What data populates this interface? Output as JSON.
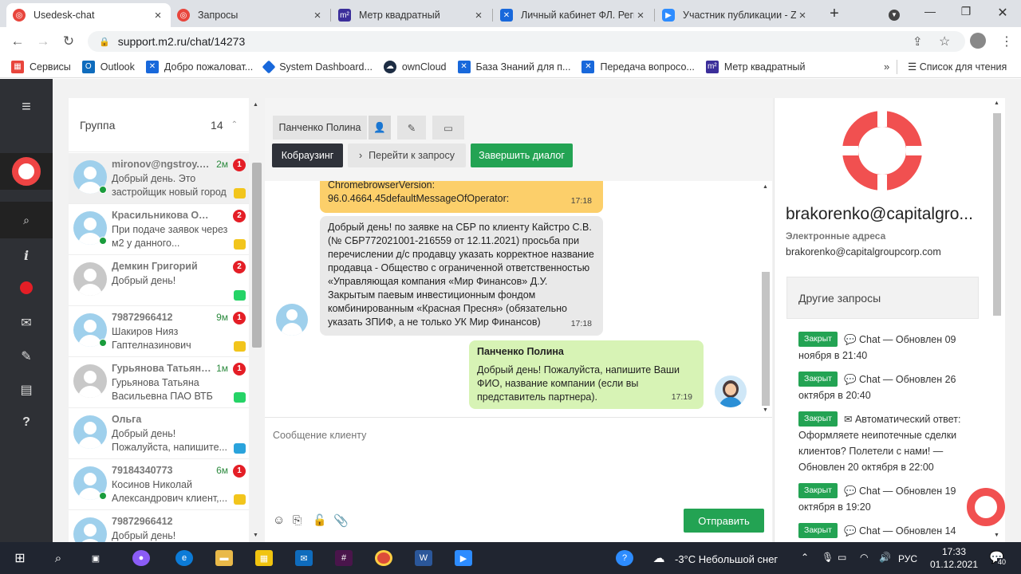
{
  "browser": {
    "tabs": [
      {
        "title": "Usedesk-chat",
        "active": true
      },
      {
        "title": "Запросы",
        "active": false
      },
      {
        "title": "Метр квадратный",
        "active": false
      },
      {
        "title": "Личный кабинет ФЛ. Регистрация",
        "active": false
      },
      {
        "title": "Участник публикации - Zoom",
        "active": false
      }
    ],
    "url": "support.m2.ru/chat/14273",
    "bookmarks": [
      {
        "label": "Сервисы",
        "icon": "apps-grid-icon",
        "color": "#e8453c"
      },
      {
        "label": "Outlook",
        "icon": "outlook-icon",
        "color": "#0f6cbd"
      },
      {
        "label": "Добро пожаловат...",
        "icon": "confluence-icon",
        "color": "#1868db"
      },
      {
        "label": "System Dashboard...",
        "icon": "jira-icon",
        "color": "#1868db"
      },
      {
        "label": "ownCloud",
        "icon": "owncloud-icon",
        "color": "#1d2d44"
      },
      {
        "label": "База Знаний для п...",
        "icon": "confluence-icon",
        "color": "#1868db"
      },
      {
        "label": "Передача вопросо...",
        "icon": "confluence-icon",
        "color": "#1868db"
      },
      {
        "label": "Метр квадратный",
        "icon": "m2-icon",
        "color": "#3b2e9a"
      }
    ],
    "more_bookmarks": "»",
    "reading_list": "Список для чтения"
  },
  "list": {
    "group_label": "Группа",
    "group_count": "14",
    "chats": [
      {
        "name": "mironov@ngstroy.com",
        "text": "Добрый день. Это застройщик новый город",
        "time": "2м",
        "badge": "1",
        "channel": "chat",
        "status": "#1a9c3c",
        "grey": false
      },
      {
        "name": "Красильникова Ольга",
        "text": "При подаче заявок через м2 у данного...",
        "time": "",
        "badge": "2",
        "channel": "chat",
        "status": "#1a9c3c",
        "grey": false
      },
      {
        "name": "Демкин Григорий",
        "text": "Добрый день!",
        "time": "",
        "badge": "2",
        "channel": "whatsapp",
        "status": "",
        "grey": true
      },
      {
        "name": "79872966412",
        "text": "Шакиров Нияз Гаптелназинович",
        "time": "9м",
        "badge": "1",
        "channel": "chat",
        "status": "#1a9c3c",
        "grey": false
      },
      {
        "name": "Гурьянова Татьяна Васильевна",
        "text": "Гурьянова Татьяна Васильевна ПАО ВТБ",
        "time": "1м",
        "badge": "1",
        "channel": "whatsapp",
        "status": "",
        "grey": true
      },
      {
        "name": "Ольга",
        "text": "Добрый день! Пожалуйста, напишите...",
        "time": "",
        "badge": "",
        "channel": "telegram",
        "status": "",
        "grey": false
      },
      {
        "name": "79184340773",
        "text": "Косинов Николай Александрович клиент,...",
        "time": "6м",
        "badge": "1",
        "channel": "chat",
        "status": "#1a9c3c",
        "grey": false
      },
      {
        "name": "79872966412",
        "text": "Добрый день! Пожалуйста, напишите...",
        "time": "",
        "badge": "",
        "channel": "chat",
        "status": "#e41e26",
        "grey": false
      }
    ]
  },
  "chat": {
    "assignee": "Панченко Полина",
    "cobrowsing_label": "Кобраузинг",
    "goto_request_label": "Перейти к запросу",
    "finish_label": "Завершить диалог",
    "messages": [
      {
        "text": "ChromebrowserVersion: 96.0.4664.45defaultMessageOfOperator:",
        "time": "17:18"
      },
      {
        "text": "Добрый день! по заявке на СБР по клиенту Кайстро С.В. (№ СБР772021001-216559 от 12.11.2021) просьба при перечислении д/с продавцу указать корректное название продавца - Общество с ограниченной ответственностью «Управляющая компания «Мир Финансов» Д.У. Закрытым паевым инвестиционным фондом комбинированным «Красная Пресня» (обязательно указать ЗПИФ, а не только УК Мир Финансов)",
        "time": "17:18"
      },
      {
        "author": "Панченко Полина",
        "text": "Добрый день! Пожалуйста, напишите Ваши ФИО, название компании (если вы представитель партнера).",
        "time": "17:19"
      }
    ],
    "input_placeholder": "Сообщение клиенту",
    "send_label": "Отправить"
  },
  "client": {
    "name": "brakorenko@capitalgro...",
    "emails_label": "Электронные адреса",
    "email": "brakorenko@capitalgroupcorp.com",
    "other_requests_label": "Другие запросы",
    "requests": [
      {
        "status": "Закрыт",
        "text": "Chat — Обновлен 09 ноября в 21:40"
      },
      {
        "status": "Закрыт",
        "text": "Chat — Обновлен 26 октября в 20:40"
      },
      {
        "status": "Закрыт",
        "text": "Автоматический ответ: Оформляете неипотечные сделки клиентов? Полетели с нами! — Обновлен 20 октября в 22:00"
      },
      {
        "status": "Закрыт",
        "text": "Chat — Обновлен 19 октября в 19:20"
      },
      {
        "status": "Закрыт",
        "text": "Chat — Обновлен 14"
      }
    ]
  },
  "taskbar": {
    "weather": "-3°C Небольшой снег",
    "lang": "РУС",
    "time": "17:33",
    "date": "01.12.2021",
    "notifications": "40"
  }
}
